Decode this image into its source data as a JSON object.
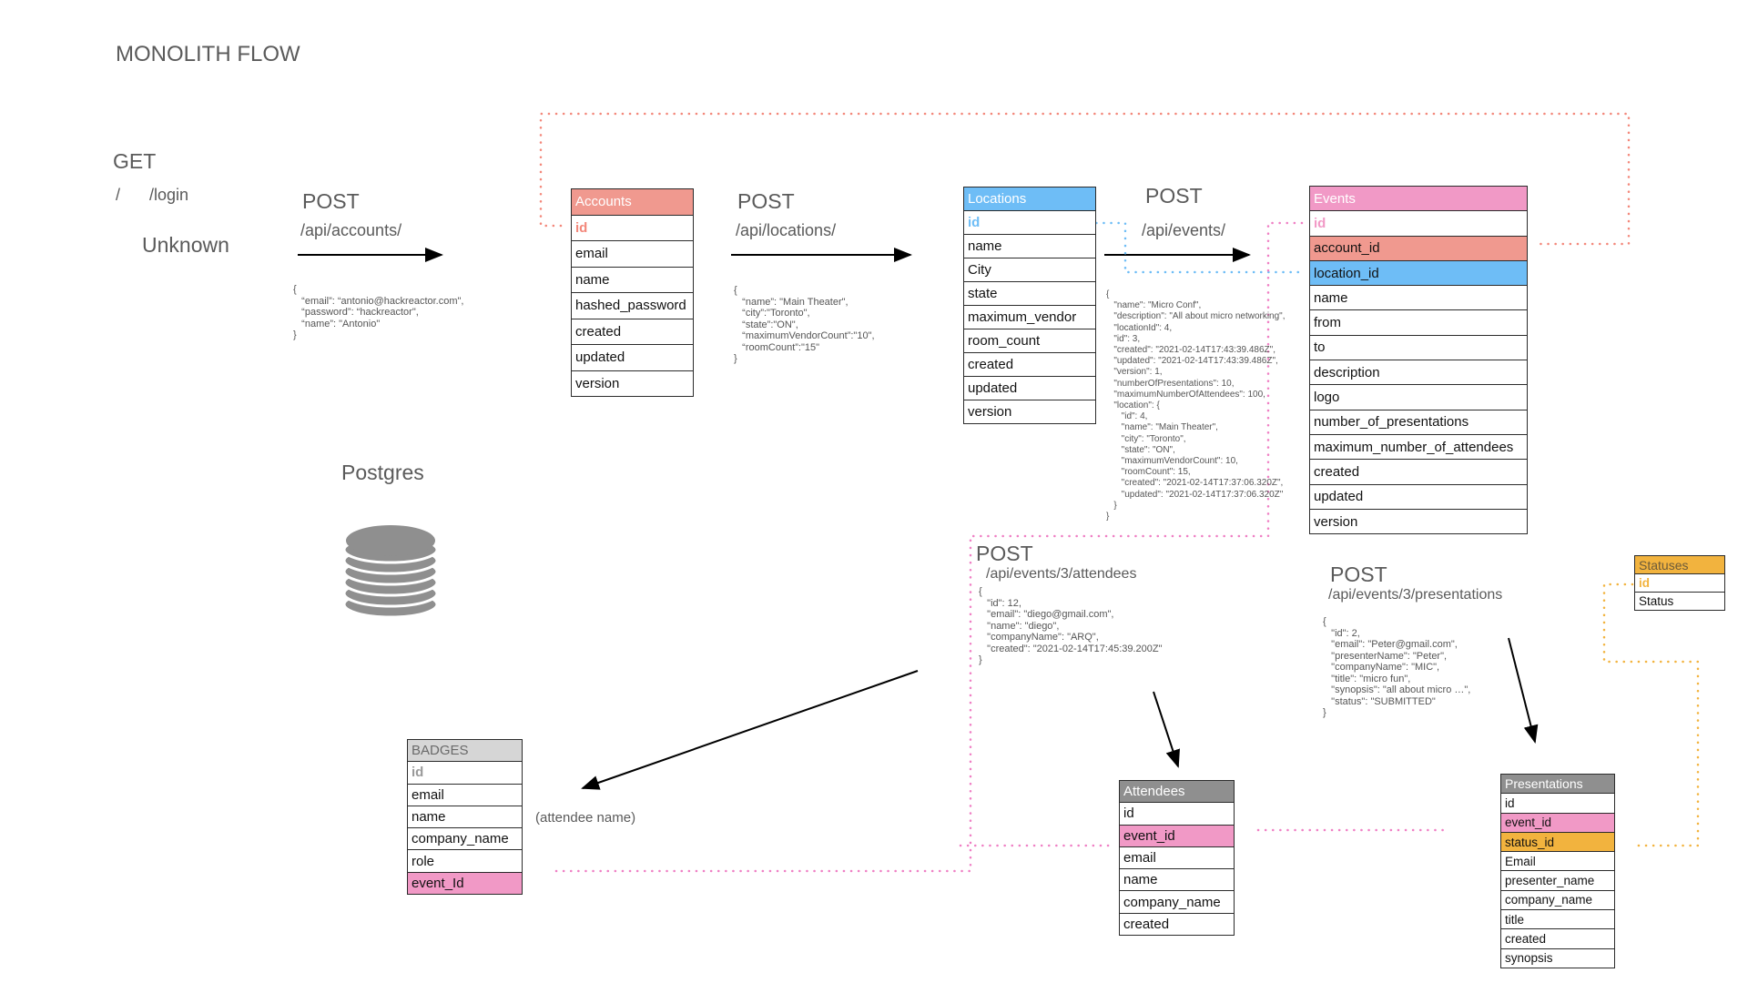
{
  "title": "MONOLITH FLOW",
  "get_section": {
    "method": "GET",
    "routes": [
      "/",
      "/login"
    ],
    "label": "Unknown"
  },
  "database": {
    "label": "Postgres",
    "icon": "database-icon"
  },
  "colors": {
    "accounts": "#f0998f",
    "locations": "#6ebdf6",
    "events": "#f199c6",
    "statuses": "#f2b33e",
    "gray_header": "#8f8f8f",
    "badges_header": "#d6d6d6",
    "pink_dots": "#ef7fc4",
    "salmon_dots": "#f3877a",
    "blue_dots": "#6ebdf6",
    "orange_dots": "#f2b33e"
  },
  "requests": {
    "accounts": {
      "method": "POST",
      "path": "/api/accounts/",
      "body": "{\n   “email”: “antonio@hackreactor.com\",\n   “password”: “hackreactor\",\n   “name”: \"Antonio\"\n}"
    },
    "locations": {
      "method": "POST",
      "path": "/api/locations/",
      "body": "{\n   “name”: \"Main Theater\",\n   “city”:\"Toronto\",\n   “state”:\"ON\",\n   “maximumVendorCount”:\"10\",\n   “roomCount”:\"15\"\n}"
    },
    "events": {
      "method": "POST",
      "path": "/api/events/",
      "body": "{\n   \"name\": \"Micro Conf\",\n   \"description\": \"All about micro networking\",\n   \"locationId\": 4,\n   \"id\": 3,\n   \"created\": \"2021-02-14T17:43:39.486Z\",\n   \"updated\": \"2021-02-14T17:43:39.486Z\",\n   \"version\": 1,\n   \"numberOfPresentations\": 10,\n   \"maximumNumberOfAttendees\": 100,\n   \"location\": {\n      \"id\": 4,\n      \"name\": \"Main Theater\",\n      \"city\": \"Toronto\",\n      \"state\": \"ON\",\n      \"maximumVendorCount\": 10,\n      \"roomCount\": 15,\n      \"created\": \"2021-02-14T17:37:06.320Z\",\n      \"updated\": \"2021-02-14T17:37:06.320Z\"\n   }\n}"
    },
    "attendees": {
      "method": "POST",
      "path": "/api/events/3/attendees",
      "body": "{\n   \"id\": 12,\n   \"email\": \"diego@gmail.com\",\n   \"name\": \"diego\",\n   \"companyName\": \"ARQ\",\n   \"created\": \"2021-02-14T17:45:39.200Z\"\n}"
    },
    "presentations": {
      "method": "POST",
      "path": "/api/events/3/presentations",
      "body": "{\n   \"id\": 2,\n   \"email\": \"Peter@gmail.com\",\n   \"presenterName\": \"Peter\",\n   \"companyName\": \"MIC\",\n   \"title\": \"micro fun\",\n   \"synopsis\": \"all about micro …\",\n   \"status\": \"SUBMITTED\"\n}"
    }
  },
  "tables": {
    "accounts": {
      "name": "Accounts",
      "fields": [
        "id",
        "email",
        "name",
        "hashed_password",
        "created",
        "updated",
        "version"
      ]
    },
    "locations": {
      "name": "Locations",
      "fields": [
        "id",
        "name",
        "City",
        "state",
        "maximum_vendor",
        "room_count",
        "created",
        "updated",
        "version"
      ]
    },
    "events": {
      "name": "Events",
      "fields": [
        "id",
        "account_id",
        "location_id",
        "name",
        "from",
        "to",
        "description",
        "logo",
        "number_of_presentations",
        "maximum_number_of_attendees",
        "created",
        "updated",
        "version"
      ]
    },
    "statuses": {
      "name": "Statuses",
      "fields": [
        "id",
        "Status"
      ]
    },
    "attendees": {
      "name": "Attendees",
      "fields": [
        "id",
        "event_id",
        "email",
        "name",
        "company_name",
        "created"
      ]
    },
    "presentations": {
      "name": "Presentations",
      "fields": [
        "id",
        "event_id",
        "status_id",
        "Email",
        "presenter_name",
        "company_name",
        "title",
        "created",
        "synopsis"
      ]
    },
    "badges": {
      "name": "BADGES",
      "fields": [
        "id",
        "email",
        "name",
        "company_name",
        "role",
        "event_Id"
      ]
    }
  },
  "annotations": {
    "badges_note": "(attendee name)"
  }
}
